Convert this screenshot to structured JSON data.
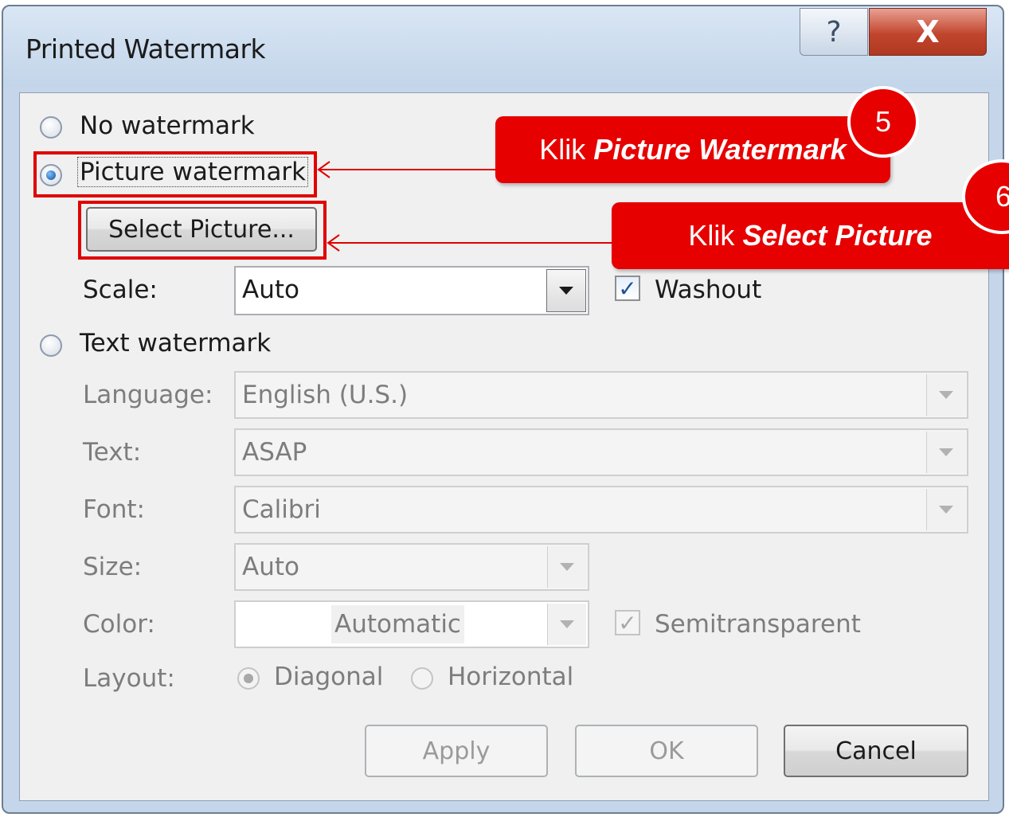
{
  "window": {
    "title": "Printed Watermark",
    "help_glyph": "?",
    "close_glyph": "X"
  },
  "options": {
    "no_watermark": {
      "label": "No watermark",
      "selected": false
    },
    "picture_watermark": {
      "label": "Picture watermark",
      "selected": true
    },
    "text_watermark": {
      "label": "Text watermark",
      "selected": false
    }
  },
  "picture": {
    "select_button": "Select Picture...",
    "scale_label": "Scale:",
    "scale_value": "Auto",
    "washout_label": "Washout",
    "washout_checked": true
  },
  "text": {
    "language_label": "Language:",
    "language_value": "English (U.S.)",
    "text_label": "Text:",
    "text_value": "ASAP",
    "font_label": "Font:",
    "font_value": "Calibri",
    "size_label": "Size:",
    "size_value": "Auto",
    "color_label": "Color:",
    "color_value": "Automatic",
    "semitransparent_label": "Semitransparent",
    "semitransparent_checked": true,
    "layout_label": "Layout:",
    "layout_diagonal": "Diagonal",
    "layout_horizontal": "Horizontal",
    "layout_selected": "Diagonal"
  },
  "buttons": {
    "apply": "Apply",
    "ok": "OK",
    "cancel": "Cancel"
  },
  "annotations": {
    "step5_number": "5",
    "step5_prefix": "Klik",
    "step5_emph": "Picture Watermark",
    "step6_number": "6",
    "step6_prefix": "Klik",
    "step6_emph": "Select Picture",
    "accent_color": "#e60000"
  }
}
